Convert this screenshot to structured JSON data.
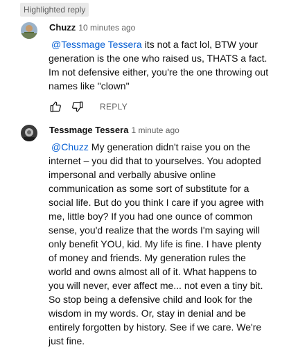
{
  "badge": "Highlighted reply",
  "comments": [
    {
      "author": "Chuzz",
      "time": "10 minutes ago",
      "mention": "@Tessmage Tessera",
      "text": "its not a fact lol, BTW your generation is the one who raised us, THATS a fact. Im not defensive either, you're the one throwing out names like \"clown\"",
      "reply_label": "REPLY"
    },
    {
      "author": "Tessmage Tessera",
      "time": "1 minute ago",
      "mention": "@Chuzz",
      "text": "My generation didn't raise you on the internet – you did that to yourselves. You adopted impersonal and verbally abusive online communication as some sort of substitute for a social life. But do you think I care if you agree with me, little boy? If you had one ounce of common sense, you'd realize that the words I'm saying will only benefit YOU, kid. My life is fine. I have plenty of money and friends. My generation rules the world and owns almost all of it. What happens to you will never, ever affect me... not even a tiny bit. So stop being a defensive child and look for the wisdom in my words. Or, stay in denial and be entirely forgotten by history. See if we care. We're just fine."
    }
  ]
}
